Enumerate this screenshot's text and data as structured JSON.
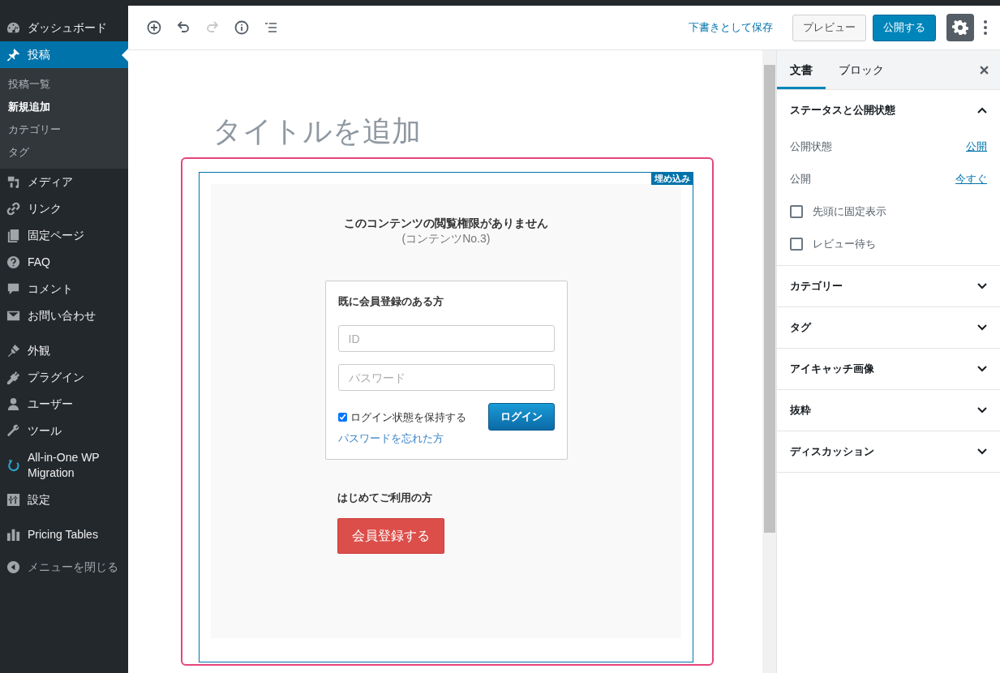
{
  "sidebar": {
    "groups": [
      {
        "items": [
          {
            "label": "ダッシュボード",
            "selected": false
          },
          {
            "label": "投稿",
            "selected": true,
            "children": [
              {
                "label": "投稿一覧",
                "selected": false
              },
              {
                "label": "新規追加",
                "selected": true
              },
              {
                "label": "カテゴリー",
                "selected": false
              },
              {
                "label": "タグ",
                "selected": false
              }
            ]
          },
          {
            "label": "メディア",
            "selected": false
          },
          {
            "label": "リンク",
            "selected": false
          },
          {
            "label": "固定ページ",
            "selected": false
          },
          {
            "label": "FAQ",
            "selected": false
          },
          {
            "label": "コメント",
            "selected": false
          },
          {
            "label": "お問い合わせ",
            "selected": false
          }
        ]
      },
      {
        "items": [
          {
            "label": "外観",
            "selected": false
          },
          {
            "label": "プラグイン",
            "selected": false
          },
          {
            "label": "ユーザー",
            "selected": false
          },
          {
            "label": "ツール",
            "selected": false
          },
          {
            "label": "All-in-One WP Migration",
            "selected": false
          },
          {
            "label": "設定",
            "selected": false
          }
        ]
      },
      {
        "items": [
          {
            "label": "Pricing Tables",
            "selected": false
          }
        ]
      }
    ],
    "collapse": "メニューを閉じる"
  },
  "toolbar": {
    "tools": [
      {
        "kind": "add",
        "disabled": false
      },
      {
        "kind": "undo",
        "disabled": false
      },
      {
        "kind": "redo",
        "disabled": true
      },
      {
        "kind": "info",
        "disabled": false
      },
      {
        "kind": "outline",
        "disabled": false
      }
    ],
    "save_draft": "下書きとして保存",
    "preview": "プレビュー",
    "publish": "公開する",
    "settings_selected": true
  },
  "editor": {
    "title_placeholder": "タイトルを追加",
    "block": {
      "label": "埋め込み",
      "selected": true,
      "notice": "このコンテンツの閲覧権限がありません",
      "content_no": "(コンテンツNo.3)",
      "login": {
        "heading": "既に会員登録のある方",
        "id_placeholder": "ID",
        "password_placeholder": "パスワード",
        "remember": {
          "label": "ログイン状態を保持する",
          "checked": true
        },
        "button": "ログイン",
        "forgot": "パスワードを忘れた方"
      },
      "new_user": {
        "heading": "はじめてご利用の方",
        "button": "会員登録する"
      }
    }
  },
  "settings_panel": {
    "tabs": [
      {
        "label": "文書",
        "selected": true
      },
      {
        "label": "ブロック",
        "selected": false
      }
    ],
    "sections": [
      {
        "title": "ステータスと公開状態",
        "expanded": true,
        "rows": [
          {
            "kind": "link",
            "label": "公開状態",
            "value": "公開"
          },
          {
            "kind": "link",
            "label": "公開",
            "value": "今すぐ"
          },
          {
            "kind": "checkbox",
            "label": "先頭に固定表示",
            "checked": false
          },
          {
            "kind": "checkbox",
            "label": "レビュー待ち",
            "checked": false
          }
        ]
      },
      {
        "title": "カテゴリー",
        "expanded": false
      },
      {
        "title": "タグ",
        "expanded": false
      },
      {
        "title": "アイキャッチ画像",
        "expanded": false
      },
      {
        "title": "抜粋",
        "expanded": false
      },
      {
        "title": "ディスカッション",
        "expanded": false
      }
    ]
  }
}
